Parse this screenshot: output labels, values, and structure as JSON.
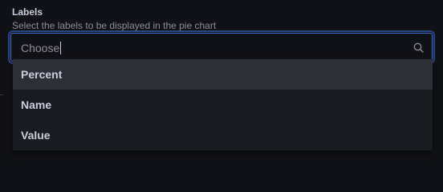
{
  "field": {
    "label": "Labels",
    "description": "Select the labels to be displayed in the pie chart"
  },
  "select": {
    "placeholder": "Choose",
    "icon": "search-icon"
  },
  "menu": {
    "items": [
      {
        "label": "Percent",
        "highlighted": true
      },
      {
        "label": "Name",
        "highlighted": false
      },
      {
        "label": "Value",
        "highlighted": false
      }
    ]
  },
  "colors": {
    "focus": "#3d71d9",
    "background": "#111217",
    "menu": "#181b1f",
    "highlight": "#2c2f35"
  }
}
